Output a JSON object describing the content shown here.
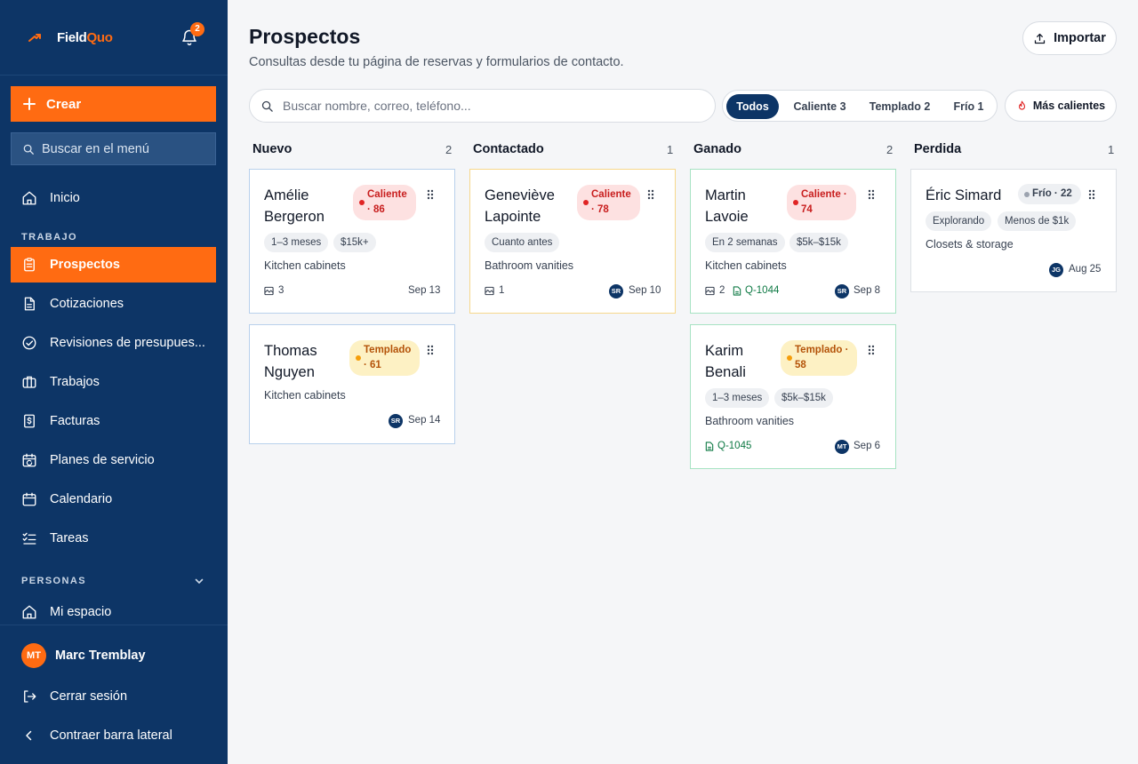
{
  "app": {
    "logo_field": "Field",
    "logo_quo": "Quo",
    "notification_count": "2"
  },
  "sidebar": {
    "create_label": "Crear",
    "search_label": "Buscar en el menú",
    "home_label": "Inicio",
    "section_trabajo": "TRABAJO",
    "items": [
      {
        "label": "Prospectos"
      },
      {
        "label": "Cotizaciones"
      },
      {
        "label": "Revisiones de presupues..."
      },
      {
        "label": "Trabajos"
      },
      {
        "label": "Facturas"
      },
      {
        "label": "Planes de servicio"
      },
      {
        "label": "Calendario"
      },
      {
        "label": "Tareas"
      }
    ],
    "section_personas": "PERSONAS",
    "my_space_label": "Mi espacio",
    "user": {
      "initials": "MT",
      "name": "Marc Tremblay"
    },
    "logout_label": "Cerrar sesión",
    "collapse_label": "Contraer barra lateral"
  },
  "header": {
    "title": "Prospectos",
    "subtitle": "Consultas desde tu página de reservas y formularios de contacto.",
    "import_label": "Importar"
  },
  "toolbar": {
    "search_placeholder": "Buscar nombre, correo, teléfono...",
    "filters": [
      "Todos",
      "Caliente 3",
      "Templado 2",
      "Frío 1"
    ],
    "hottest_label": "Más calientes"
  },
  "columns": [
    {
      "title": "Nuevo",
      "count": "2"
    },
    {
      "title": "Contactado",
      "count": "1"
    },
    {
      "title": "Ganado",
      "count": "2"
    },
    {
      "title": "Perdida",
      "count": "1"
    }
  ],
  "cards": [
    {
      "name_1": "Amélie",
      "name_2": "Bergeron",
      "badge_1": "Caliente",
      "badge_2": "· 86",
      "tags": [
        "1–3 meses",
        "$15k+"
      ],
      "desc": "Kitchen cabinets",
      "photos": "3",
      "date": "Sep 13"
    },
    {
      "name_1": "Thomas",
      "name_2": "Nguyen",
      "badge_1": "Templado",
      "badge_2": "· 61",
      "desc": "Kitchen cabinets",
      "avatar": "SR",
      "date": "Sep 14"
    },
    {
      "name_1": "Geneviève",
      "name_2": "Lapointe",
      "badge_1": "Caliente",
      "badge_2": "· 78",
      "tags": [
        "Cuanto antes"
      ],
      "desc": "Bathroom vanities",
      "photos": "1",
      "avatar": "SR",
      "date": "Sep 10"
    },
    {
      "name_1": "Martin",
      "name_2": "Lavoie",
      "badge_1": "Caliente ·",
      "badge_2": "74",
      "tags": [
        "En 2 semanas",
        "$5k–$15k"
      ],
      "desc": "Kitchen cabinets",
      "photos": "2",
      "quote": "Q-1044",
      "avatar": "SR",
      "date": "Sep 8"
    },
    {
      "name_1": "Karim",
      "name_2": "Benali",
      "badge_1": "Templado ·",
      "badge_2": "58",
      "tags": [
        "1–3 meses",
        "$5k–$15k"
      ],
      "desc": "Bathroom vanities",
      "quote": "Q-1045",
      "avatar": "MT",
      "date": "Sep 6"
    },
    {
      "name_1": "Éric Simard",
      "badge_1": "Frío · 22",
      "tags": [
        "Explorando",
        "Menos de $1k"
      ],
      "desc": "Closets & storage",
      "avatar": "JG",
      "date": "Aug 25"
    }
  ],
  "colors": {
    "sidebar": "#0d3566",
    "accent": "#ff6b12",
    "hot": "#e02424",
    "warm": "#f59e0b",
    "cold": "#9ca3af",
    "quote": "#0f7a45"
  },
  "icons": [
    "trend-up-icon",
    "bell-icon",
    "plus-icon",
    "search-icon",
    "home-icon",
    "clipboard-icon",
    "document-icon",
    "check-circle-icon",
    "briefcase-icon",
    "dollar-document-icon",
    "calendar-repeat-icon",
    "calendar-icon",
    "checklist-icon",
    "chevron-down-icon",
    "logout-icon",
    "chevron-left-icon",
    "upload-icon",
    "flame-icon",
    "drag-handle-icon",
    "image-icon",
    "file-icon"
  ]
}
